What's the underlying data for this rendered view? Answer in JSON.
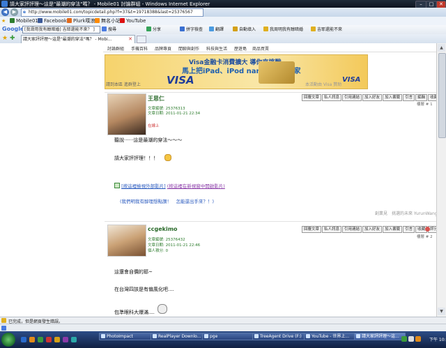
{
  "window": {
    "title": "請大家評評理～這是\"最潮的穿法\"嗎？ - Mobile01 討論群組 - Windows Internet Explorer"
  },
  "address": {
    "url": "http://www.mobile01.com/topicdetail.php?f=37&t=19718388&last=25376567"
  },
  "favorites": [
    {
      "label": "Mobile01",
      "color": "#2d7d2d"
    },
    {
      "label": "Facebook",
      "color": "#3b5998"
    },
    {
      "label": "Plurk噗浪",
      "color": "#e46a1a"
    },
    {
      "label": "無名小站",
      "color": "#ff8a00"
    },
    {
      "label": "YouTube",
      "color": "#d11"
    }
  ],
  "gtoolbar": {
    "search_value": "[我滑用我有醇暗婚] 吉耶還能不來？ ]",
    "items": [
      "搜尋",
      "分享",
      "拼字檢查",
      "翻譯",
      "自動填入",
      "我周明我有醇暗婚",
      "吉耶還能不來"
    ]
  },
  "tab": {
    "label": "請大家評評理～這是\"最潮的穿法\"嗎？ - Mobi..."
  },
  "forum_menu": [
    "討論群組",
    "手機百科",
    "品牌專頁",
    "閒聊與創作",
    "科技與生活",
    "歷遊島",
    "商品買賣"
  ],
  "banner": {
    "line1": "Visa金融卡消費擴大 導你來挑戰",
    "line2": "馬上把iPad、iPod nano好禮帶回家",
    "visa": "VISA",
    "visa2": "VISA",
    "sub_left": "請到本區 進群登上",
    "sub_right": "本活動由 Visa 贊助"
  },
  "post_buttons": [
    "回覆文章",
    "私人訊息",
    "引用連結",
    "加入好友",
    "加入書籤",
    "引言",
    "編輯",
    "收藏",
    "評分",
    "回報"
  ],
  "post1": {
    "author": "王思仁",
    "article_id": "文章編號: 25376313",
    "date": "文章日期: 2011-01-21 22:34",
    "floor": "樓層 # 1",
    "note": "在線上",
    "lines": [
      "聽說‧‧‧‧‧‧這是最潮的穿法～～～",
      "請大家評評理！！！"
    ],
    "link1": "[按這裡檢視外部影片]",
    "link2": "(按這裡在新視窗中開啟影片)",
    "footer": "(我們明我有醇理想點讚！　怎能還出手來？！)",
    "sig": "創業見　挑選的未來 YurunWang"
  },
  "post2": {
    "author": "ccgekimo",
    "article_id": "文章編號: 25376432",
    "date": "文章日期: 2011-01-21 22:46",
    "points": "個人積分: 0",
    "floor": "樓層 # 2",
    "lines": [
      "這還會自價的耶~",
      "在台灣四該是有偏風化吧....",
      "包準眼科大爆滿...."
    ]
  },
  "status": {
    "text": "已完成，但是網頁發生錯誤。"
  },
  "quicklaunch": {
    "text": ""
  },
  "taskbar": {
    "tasks": [
      "PhotoImpact",
      "RealPlayer Downlo...",
      "pge",
      "TreeAgent Drive (F:)",
      "YouTube - 世界上...",
      "請大家評評理～這..."
    ],
    "clock": "下午 10:50"
  }
}
